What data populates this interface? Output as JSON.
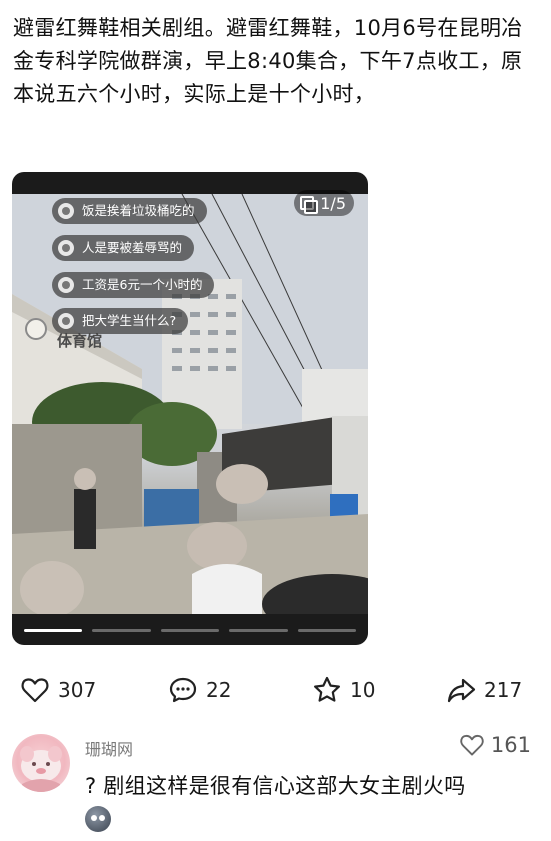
{
  "post": {
    "text": "避雷红舞鞋相关剧组。避雷红舞鞋，10月6号在昆明冶金专科学院做群演，早上8:40集合，下午7点收工，原本说五六个小时，实际上是十个小时，"
  },
  "media": {
    "counter": "1/5",
    "pages_total": 5,
    "current_page": 1,
    "bubbles": [
      "饭是挨着垃圾桶吃的",
      "人是要被羞辱骂的",
      "工资是6元一个小时的",
      "把大学生当什么?"
    ],
    "building_sign": "体育馆"
  },
  "actions": {
    "like": {
      "count": "307",
      "icon": "heart-outline-icon"
    },
    "comment": {
      "count": "22",
      "icon": "chat-bubble-icon"
    },
    "favorite": {
      "count": "10",
      "icon": "star-outline-icon"
    },
    "share": {
      "count": "217",
      "icon": "share-arrow-icon"
    }
  },
  "comment": {
    "username": "珊瑚网",
    "text": "? 剧组这样是很有信心这部大女主剧火吗",
    "likes": "161"
  }
}
